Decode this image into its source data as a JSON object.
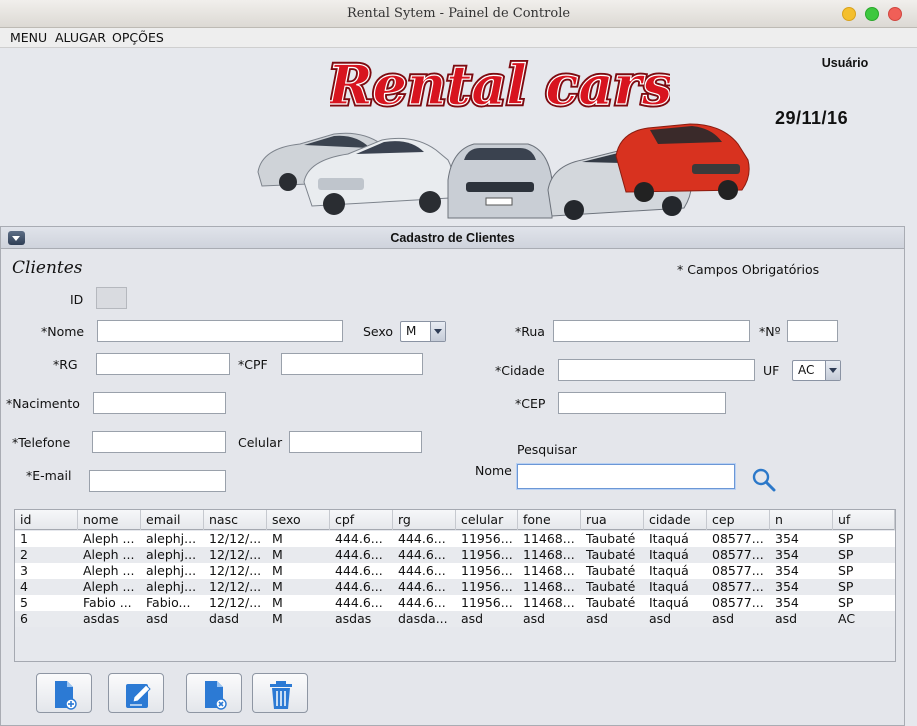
{
  "window": {
    "title": "Rental Sytem - Painel de Controle"
  },
  "menu": {
    "items": [
      "MENU",
      "ALUGAR",
      "OPÇÕES"
    ]
  },
  "header": {
    "logo_text": "Rental cars",
    "user_label": "Usuário",
    "date": "29/11/16"
  },
  "panel": {
    "title": "Cadastro de Clientes"
  },
  "form": {
    "section_title": "Clientes",
    "required_note": "* Campos Obrigatórios",
    "labels": {
      "id": "ID",
      "nome": "*Nome",
      "sexo": "Sexo",
      "rg": "*RG",
      "cpf": "*CPF",
      "nascimento": "*Nacimento",
      "telefone": "*Telefone",
      "celular": "Celular",
      "email": "*E-mail",
      "rua": "*Rua",
      "numero": "*Nº",
      "cidade": "*Cidade",
      "uf": "UF",
      "cep": "*CEP",
      "pesquisar": "Pesquisar",
      "search_nome": "Nome"
    },
    "values": {
      "id": "",
      "nome": "",
      "rg": "",
      "cpf": "",
      "nascimento": "",
      "telefone": "",
      "celular": "",
      "email": "",
      "rua": "",
      "numero": "",
      "cidade": "",
      "cep": "",
      "search": ""
    },
    "sexo_selected": "M",
    "uf_selected": "AC"
  },
  "table": {
    "columns": [
      "id",
      "nome",
      "email",
      "nasc",
      "sexo",
      "cpf",
      "rg",
      "celular",
      "fone",
      "rua",
      "cidade",
      "cep",
      "n",
      "uf"
    ],
    "rows": [
      [
        "1",
        "Aleph ...",
        "alephj...",
        "12/12/...",
        "M",
        "444.6...",
        "444.6...",
        "11956...",
        "11468...",
        "Taubaté",
        "Itaquá",
        "08577...",
        "354",
        "SP"
      ],
      [
        "2",
        "Aleph ...",
        "alephj...",
        "12/12/...",
        "M",
        "444.6...",
        "444.6...",
        "11956...",
        "11468...",
        "Taubaté",
        "Itaquá",
        "08577...",
        "354",
        "SP"
      ],
      [
        "3",
        "Aleph ...",
        "alephj...",
        "12/12/...",
        "M",
        "444.6...",
        "444.6...",
        "11956...",
        "11468...",
        "Taubaté",
        "Itaquá",
        "08577...",
        "354",
        "SP"
      ],
      [
        "4",
        "Aleph ...",
        "alephj...",
        "12/12/...",
        "M",
        "444.6...",
        "444.6...",
        "11956...",
        "11468...",
        "Taubaté",
        "Itaquá",
        "08577...",
        "354",
        "SP"
      ],
      [
        "5",
        "Fabio ...",
        "Fabio...",
        "12/12/...",
        "M",
        "444.6...",
        "444.6...",
        "11956...",
        "11468...",
        "Taubaté",
        "Itaquá",
        "08577...",
        "354",
        "SP"
      ],
      [
        "6",
        "asdas",
        "asd",
        "dasd",
        "M",
        "asdas",
        "dasda...",
        "asd",
        "asd",
        "asd",
        "asd",
        "asd",
        "asd",
        "AC"
      ]
    ]
  },
  "toolbar": {
    "buttons": [
      "new-client-icon",
      "edit-client-icon",
      "remove-file-icon",
      "trash-icon"
    ]
  }
}
